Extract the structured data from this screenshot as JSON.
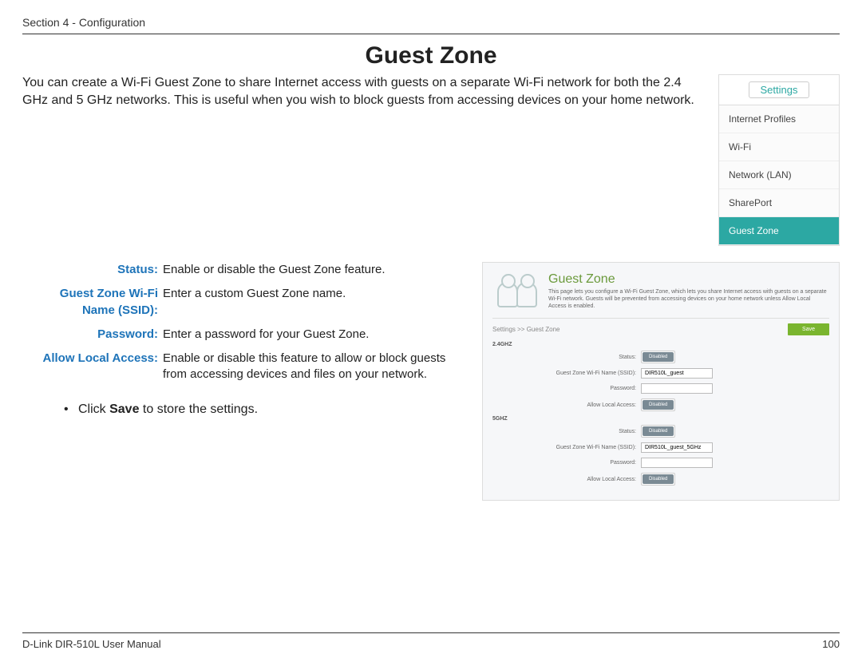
{
  "header": {
    "section_label": "Section 4 - Configuration"
  },
  "title": "Guest Zone",
  "intro": "You can create a Wi-Fi Guest Zone to share Internet access with guests on a separate Wi-Fi network for both the 2.4 GHz and 5 GHz networks. This is useful when you wish to block guests from accessing devices on your home network.",
  "menu": {
    "button": "Settings",
    "items": [
      "Internet Profiles",
      "Wi-Fi",
      "Network (LAN)",
      "SharePort",
      "Guest Zone"
    ]
  },
  "definitions": {
    "status_term": "Status:",
    "status_desc": "Enable or disable the Guest Zone feature.",
    "ssid_term_l1": "Guest Zone Wi-Fi",
    "ssid_term_l2": "Name (SSID):",
    "ssid_desc": "Enter a custom Guest Zone name.",
    "password_term": "Password:",
    "password_desc": "Enter a password for your Guest Zone.",
    "local_term": "Allow Local Access:",
    "local_desc": "Enable or disable this feature to allow or block guests from accessing devices and files on your network."
  },
  "save_line_prefix": "Click ",
  "save_word": "Save",
  "save_line_suffix": " to store the settings.",
  "app": {
    "title": "Guest Zone",
    "desc": "This page lets you configure a Wi-Fi Guest Zone, which lets you share Internet access with guests on a separate Wi-Fi network. Guests will be prevented from accessing devices on your home network unless Allow Local Access is enabled.",
    "breadcrumb": "Settings >> Guest Zone",
    "save_btn": "Save",
    "band24": "2.4GHZ",
    "band5": "5GHZ",
    "labels": {
      "status": "Status:",
      "ssid": "Guest Zone Wi-Fi Name (SSID):",
      "password": "Password:",
      "allow_local": "Allow Local Access:"
    },
    "toggle": "Disabled",
    "values": {
      "ssid24": "DIR510L_guest",
      "pw24": "",
      "ssid5": "DIR510L_guest_5GHz",
      "pw5": ""
    }
  },
  "footer": {
    "left": "D-Link DIR-510L User Manual",
    "right": "100"
  }
}
